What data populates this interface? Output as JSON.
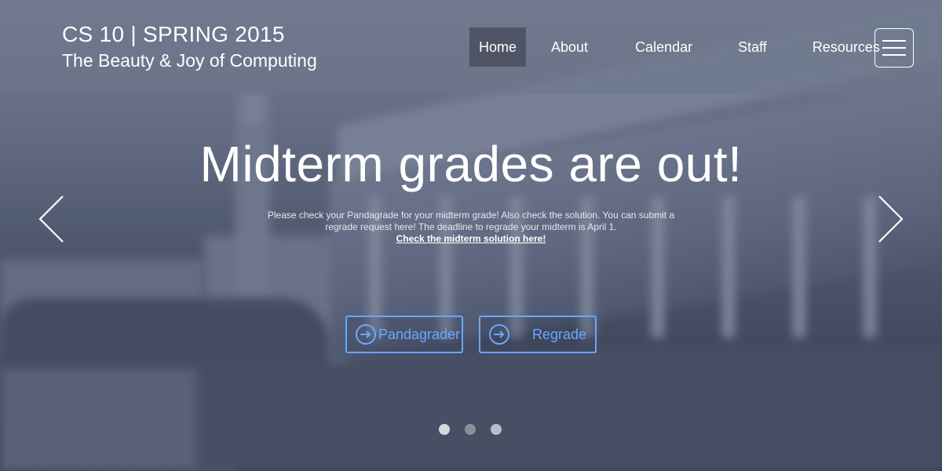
{
  "brand": {
    "title": "CS 10 | SPRING 2015",
    "subtitle": "The Beauty & Joy of Computing"
  },
  "nav": {
    "items": [
      {
        "label": "Home",
        "active": true
      },
      {
        "label": "About",
        "active": false
      },
      {
        "label": "Calendar",
        "active": false
      },
      {
        "label": "Staff",
        "active": false
      },
      {
        "label": "Resources",
        "active": false
      }
    ],
    "menu_icon": "hamburger-menu-icon"
  },
  "slide": {
    "headline": "Midterm grades are out!",
    "body": "Please check your Pandagrade for your midterm grade! Also check the solution. You can submit a regrade request here! The deadline to regrade your midterm is April 1.",
    "link": "Check the midterm solution here!",
    "buttons": [
      {
        "label": "Pandagrader",
        "icon": "arrow-circle-right-icon"
      },
      {
        "label": "Regrade",
        "icon": "arrow-circle-right-icon"
      }
    ],
    "prev_icon": "chevron-left-icon",
    "next_icon": "chevron-right-icon",
    "pager": {
      "count": 3,
      "current": 1
    }
  },
  "colors": {
    "accent": "#6aa7ff",
    "header_bg": "#6e768a",
    "active_nav_bg": "#464a5a"
  }
}
